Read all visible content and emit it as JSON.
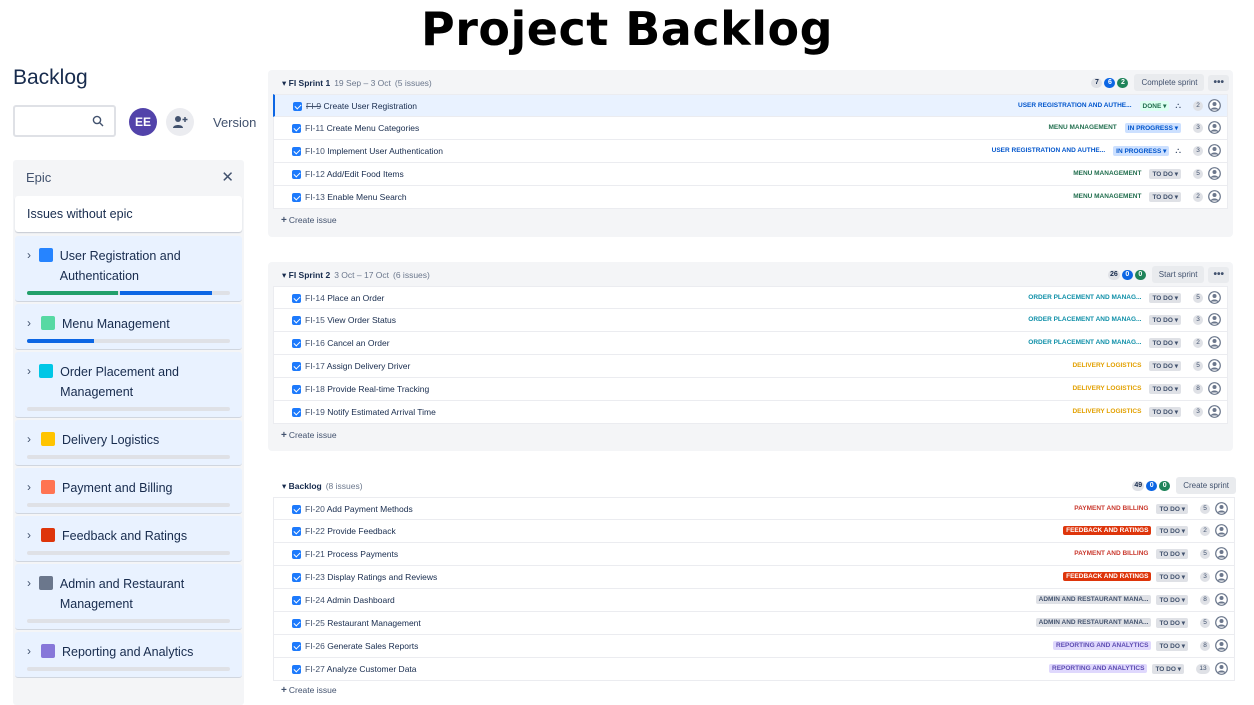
{
  "page_title": "Project Backlog",
  "header": {
    "heading": "Backlog",
    "search_placeholder": "",
    "avatar_initials": "EE",
    "version_label": "Version"
  },
  "epic_panel": {
    "title": "Epic",
    "no_epic_label": "Issues without epic",
    "epics": [
      {
        "name": "User Registration and Authentication",
        "color": "#2684ff",
        "progress_done": 0.45,
        "progress_inprogress": 0.45
      },
      {
        "name": "Menu Management",
        "color": "#57d9a3",
        "progress_done": 0.0,
        "progress_inprogress": 0.33
      },
      {
        "name": "Order Placement and Management",
        "color": "#00c7e6",
        "progress_done": 0.0,
        "progress_inprogress": 0.0
      },
      {
        "name": "Delivery Logistics",
        "color": "#ffc400",
        "progress_done": 0.0,
        "progress_inprogress": 0.0
      },
      {
        "name": "Payment and Billing",
        "color": "#ff7452",
        "progress_done": 0.0,
        "progress_inprogress": 0.0
      },
      {
        "name": "Feedback and Ratings",
        "color": "#de350b",
        "progress_done": 0.0,
        "progress_inprogress": 0.0
      },
      {
        "name": "Admin and Restaurant Management",
        "color": "#6b778c",
        "progress_done": 0.0,
        "progress_inprogress": 0.0
      },
      {
        "name": "Reporting and Analytics",
        "color": "#8777d9",
        "progress_done": 0.0,
        "progress_inprogress": 0.0
      }
    ]
  },
  "sprint1": {
    "name": "FI Sprint 1",
    "dates": "19 Sep – 3 Oct",
    "count": "(5 issues)",
    "points": {
      "todo": "7",
      "inprogress": "6",
      "done": "2"
    },
    "action": "Complete sprint",
    "create_label": "Create issue",
    "issues": [
      {
        "key": "FI-9",
        "summary": "Create User Registration",
        "epic": "USER REGISTRATION AND AUTHE...",
        "epic_color": "#0055cc",
        "epic_bg": "transparent",
        "status": "DONE",
        "status_kind": "done",
        "child": true,
        "estimate": "2",
        "selected": true
      },
      {
        "key": "FI-11",
        "summary": "Create Menu Categories",
        "epic": "MENU MANAGEMENT",
        "epic_color": "#216e4e",
        "epic_bg": "transparent",
        "status": "IN PROGRESS",
        "status_kind": "prog",
        "child": false,
        "estimate": "3",
        "selected": false
      },
      {
        "key": "FI-10",
        "summary": "Implement User Authentication",
        "epic": "USER REGISTRATION AND AUTHE...",
        "epic_color": "#0055cc",
        "epic_bg": "transparent",
        "status": "IN PROGRESS",
        "status_kind": "prog",
        "child": true,
        "estimate": "3",
        "selected": false
      },
      {
        "key": "FI-12",
        "summary": "Add/Edit Food Items",
        "epic": "MENU MANAGEMENT",
        "epic_color": "#216e4e",
        "epic_bg": "transparent",
        "status": "TO DO",
        "status_kind": "todo",
        "child": false,
        "estimate": "5",
        "selected": false
      },
      {
        "key": "FI-13",
        "summary": "Enable Menu Search",
        "epic": "MENU MANAGEMENT",
        "epic_color": "#216e4e",
        "epic_bg": "transparent",
        "status": "TO DO",
        "status_kind": "todo",
        "child": false,
        "estimate": "2",
        "selected": false
      }
    ]
  },
  "sprint2": {
    "name": "FI Sprint 2",
    "dates": "3 Oct – 17 Oct",
    "count": "(6 issues)",
    "points": {
      "todo": "26",
      "inprogress": "0",
      "done": "0"
    },
    "action": "Start sprint",
    "create_label": "Create issue",
    "issues": [
      {
        "key": "FI-14",
        "summary": "Place an Order",
        "epic": "ORDER PLACEMENT AND MANAG...",
        "epic_color": "#0e8fa8",
        "epic_bg": "transparent",
        "status": "TO DO",
        "status_kind": "todo",
        "child": false,
        "estimate": "5"
      },
      {
        "key": "FI-15",
        "summary": "View Order Status",
        "epic": "ORDER PLACEMENT AND MANAG...",
        "epic_color": "#0e8fa8",
        "epic_bg": "transparent",
        "status": "TO DO",
        "status_kind": "todo",
        "child": false,
        "estimate": "3"
      },
      {
        "key": "FI-16",
        "summary": "Cancel an Order",
        "epic": "ORDER PLACEMENT AND MANAG...",
        "epic_color": "#0e8fa8",
        "epic_bg": "transparent",
        "status": "TO DO",
        "status_kind": "todo",
        "child": false,
        "estimate": "2"
      },
      {
        "key": "FI-17",
        "summary": "Assign Delivery Driver",
        "epic": "DELIVERY LOGISTICS",
        "epic_color": "#e2a000",
        "epic_bg": "transparent",
        "status": "TO DO",
        "status_kind": "todo",
        "child": false,
        "estimate": "5"
      },
      {
        "key": "FI-18",
        "summary": "Provide Real-time Tracking",
        "epic": "DELIVERY LOGISTICS",
        "epic_color": "#e2a000",
        "epic_bg": "transparent",
        "status": "TO DO",
        "status_kind": "todo",
        "child": false,
        "estimate": "8"
      },
      {
        "key": "FI-19",
        "summary": "Notify Estimated Arrival Time",
        "epic": "DELIVERY LOGISTICS",
        "epic_color": "#e2a000",
        "epic_bg": "transparent",
        "status": "TO DO",
        "status_kind": "todo",
        "child": false,
        "estimate": "3"
      }
    ]
  },
  "backlog": {
    "name": "Backlog",
    "count": "(8 issues)",
    "points": {
      "todo": "49",
      "inprogress": "0",
      "done": "0"
    },
    "action": "Create sprint",
    "create_label": "Create issue",
    "issues": [
      {
        "key": "FI-20",
        "summary": "Add Payment Methods",
        "epic": "PAYMENT AND BILLING",
        "epic_color": "#c9372c",
        "epic_bg": "transparent",
        "status": "TO DO",
        "status_kind": "todo",
        "child": false,
        "estimate": "5"
      },
      {
        "key": "FI-22",
        "summary": "Provide Feedback",
        "epic": "FEEDBACK AND RATINGS",
        "epic_color": "#ffffff",
        "epic_bg": "#de350b",
        "status": "TO DO",
        "status_kind": "todo",
        "child": false,
        "estimate": "2"
      },
      {
        "key": "FI-21",
        "summary": "Process Payments",
        "epic": "PAYMENT AND BILLING",
        "epic_color": "#c9372c",
        "epic_bg": "transparent",
        "status": "TO DO",
        "status_kind": "todo",
        "child": false,
        "estimate": "5"
      },
      {
        "key": "FI-23",
        "summary": "Display Ratings and Reviews",
        "epic": "FEEDBACK AND RATINGS",
        "epic_color": "#ffffff",
        "epic_bg": "#de350b",
        "status": "TO DO",
        "status_kind": "todo",
        "child": false,
        "estimate": "3"
      },
      {
        "key": "FI-24",
        "summary": "Admin Dashboard",
        "epic": "ADMIN AND RESTAURANT MANA...",
        "epic_color": "#44546f",
        "epic_bg": "#dfe1e6",
        "status": "TO DO",
        "status_kind": "todo",
        "child": false,
        "estimate": "8"
      },
      {
        "key": "FI-25",
        "summary": "Restaurant Management",
        "epic": "ADMIN AND RESTAURANT MANA...",
        "epic_color": "#44546f",
        "epic_bg": "#dfe1e6",
        "status": "TO DO",
        "status_kind": "todo",
        "child": false,
        "estimate": "5"
      },
      {
        "key": "FI-26",
        "summary": "Generate Sales Reports",
        "epic": "REPORTING AND ANALYTICS",
        "epic_color": "#5e4db2",
        "epic_bg": "#dfd8fd",
        "status": "TO DO",
        "status_kind": "todo",
        "child": false,
        "estimate": "8"
      },
      {
        "key": "FI-27",
        "summary": "Analyze Customer Data",
        "epic": "REPORTING AND ANALYTICS",
        "epic_color": "#5e4db2",
        "epic_bg": "#dfd8fd",
        "status": "TO DO",
        "status_kind": "todo",
        "child": false,
        "estimate": "13"
      }
    ]
  }
}
